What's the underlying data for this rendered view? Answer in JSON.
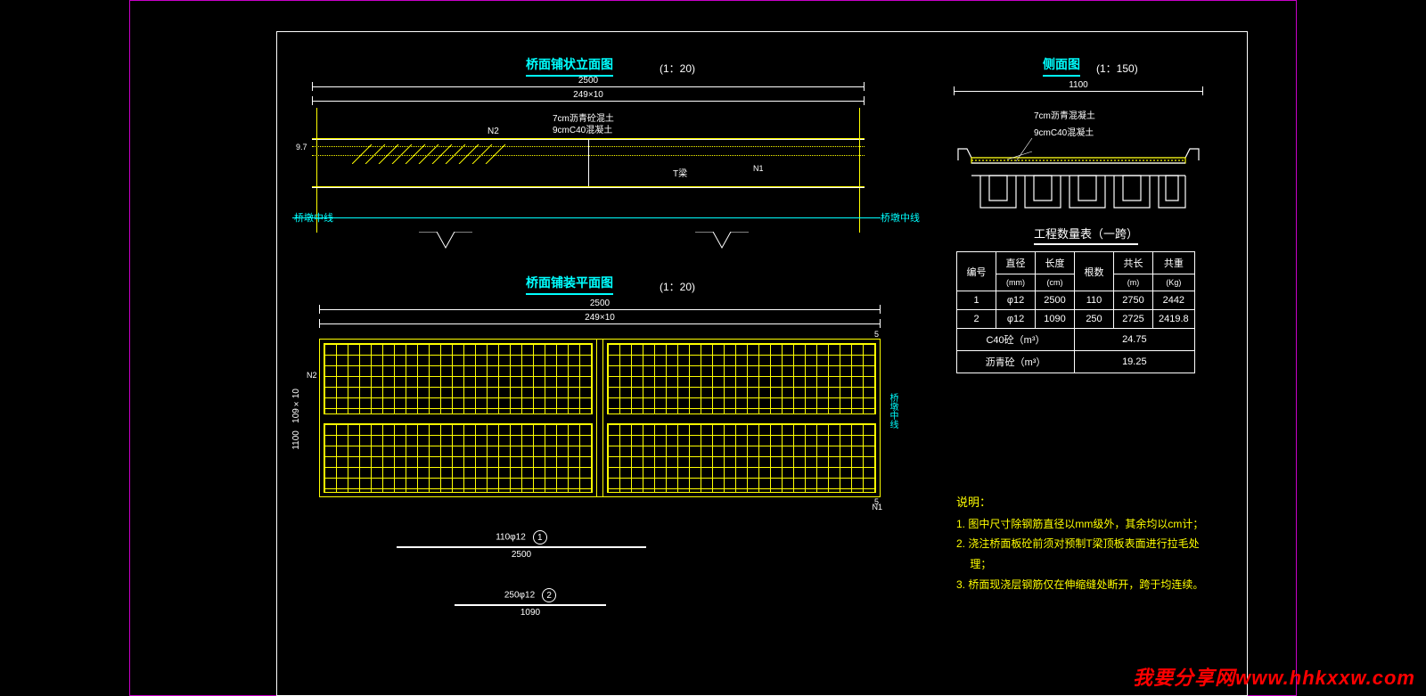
{
  "drawing": {
    "elevation": {
      "title": "桥面铺状立面图",
      "scale": "(1：20)",
      "dim_total": "2500",
      "dim_spacing": "249×10",
      "layer_asphalt": "7cm沥青砼混土",
      "layer_c40": "9cmC40混凝土",
      "bar_n2": "N2",
      "t_beam": "T梁",
      "left_vert_dim": "9.7",
      "n1": "N1",
      "centerline_label": "桥墩中线"
    },
    "side": {
      "title": "侧面图",
      "scale": "(1：150)",
      "width": "1100",
      "layer_asphalt": "7cm沥青混凝土",
      "layer_c40": "9cmC40混凝土"
    },
    "plan": {
      "title": "桥面铺装平面图",
      "scale": "(1：20)",
      "dim_total": "2500",
      "dim_spacing": "249×10",
      "left_dim_total": "1100",
      "left_dim_spacing": "109×10",
      "right_label": "桥墩中线",
      "n1": "N1",
      "n2": "N2",
      "edge_5": "5"
    },
    "callouts": {
      "bar1_spec": "110φ12",
      "bar1_len": "2500",
      "bar1_num": "1",
      "bar2_spec": "250φ12",
      "bar2_len": "1090",
      "bar2_num": "2"
    },
    "table": {
      "title": "工程数量表（一跨）",
      "headers": {
        "c1": "编号",
        "c2": "直径",
        "c2u": "(mm)",
        "c3": "长度",
        "c3u": "(cm)",
        "c4": "根数",
        "c5": "共长",
        "c5u": "(m)",
        "c6": "共重",
        "c6u": "(Kg)"
      },
      "rows": [
        {
          "no": "1",
          "dia": "φ12",
          "len": "2500",
          "qty": "110",
          "tot": "2750",
          "wt": "2442"
        },
        {
          "no": "2",
          "dia": "φ12",
          "len": "1090",
          "qty": "250",
          "tot": "2725",
          "wt": "2419.8"
        }
      ],
      "c40_label": "C40砼（m³）",
      "c40_val": "24.75",
      "asphalt_label": "沥青砼（m³）",
      "asphalt_val": "19.25"
    },
    "notes": {
      "title": "说明：",
      "n1": "1. 图中尺寸除钢筋直径以mm级外，其余均以cm计；",
      "n2": "2. 浇注桥面板砼前须对预制T梁顶板表面进行拉毛处",
      "n2b": "　 理；",
      "n3": "3. 桥面现浇层钢筋仅在伸缩缝处断开，跨于均连续。"
    },
    "watermark": "我要分享网www.hhkxxw.com"
  }
}
